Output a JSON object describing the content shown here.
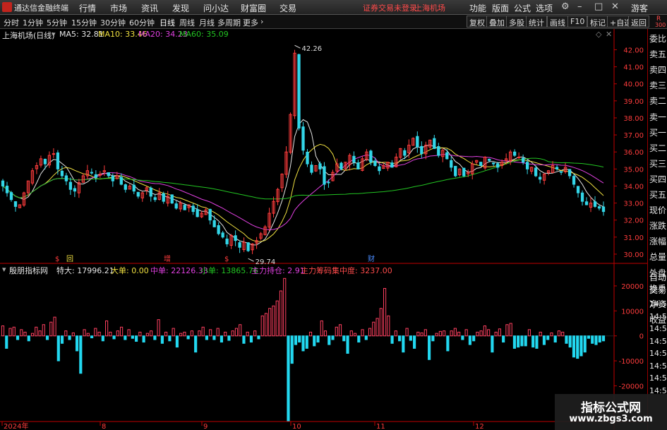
{
  "app": {
    "title": "通达信金融终端"
  },
  "menu": [
    "行情",
    "市场",
    "资讯",
    "发现",
    "问小达",
    "财富圈",
    "交易"
  ],
  "login": {
    "status": "证券交易未登录",
    "market": "上海机场"
  },
  "right_menu": [
    "功能",
    "版面",
    "公式",
    "选项"
  ],
  "window_controls": {
    "settings": "⚙",
    "minimize": "–",
    "maximize": "□",
    "close": "✕"
  },
  "guest": "游客",
  "periods": [
    "分时",
    "1分钟",
    "5分钟",
    "15分钟",
    "30分钟",
    "60分钟",
    "日线",
    "周线",
    "月线",
    "多周期",
    "更多"
  ],
  "active_period": "日线",
  "more_arrow": "›",
  "tool_buttons": [
    "复权",
    "叠加",
    "多股",
    "统计",
    "画线",
    "F10",
    "标记",
    "+自选",
    "返回"
  ],
  "corner": {
    "r": "R",
    "num": "300"
  },
  "main_info": {
    "stock": "上海机场(日线)",
    "ma5": "MA5: 32.81",
    "ma10": "MA10: 33.46",
    "ma20": "MA20: 34.23",
    "ma60": "MA60: 35.09"
  },
  "indicator_info": {
    "name": "殷朋指标网",
    "td_label": "特大: 17996.21",
    "dd_label": "大单: 0.00",
    "zd_label": "中单: 22126.33",
    "xd_label": "小单: 13865.76",
    "zl_label": "主力持仓: 2.91",
    "jzd_label": "主力筹码集中度: 3237.00"
  },
  "side_panel": {
    "items": [
      "委比",
      "卖五",
      "卖四",
      "卖三",
      "卖二",
      "卖一",
      "买一",
      "买二",
      "买三",
      "买四",
      "买五",
      "现价",
      "涨跌",
      "涨幅",
      "总量",
      "外盘",
      "换手",
      "净资",
      "收益"
    ],
    "lower": [
      "自动",
      "交易"
    ],
    "times": [
      "14:56",
      "14:56",
      "14:56",
      "14:56",
      "14:56",
      "14:56",
      "14:56",
      "14:56"
    ]
  },
  "colors": {
    "up": "#ff3c3c",
    "down": "#33d6e8",
    "ma5": "#e6e6e6",
    "ma10": "#f0e040",
    "ma20": "#e040e0",
    "ma60": "#22c422",
    "indicator_up": "#ff4060",
    "indicator_down": "#22d8f0",
    "axis_red": "#c00000"
  },
  "chart_data": [
    {
      "type": "candlestick",
      "y_ticks": [
        "42.00",
        "41.00",
        "40.00",
        "39.00",
        "38.00",
        "37.00",
        "36.00",
        "35.00",
        "34.00",
        "33.00",
        "32.00",
        "31.00",
        "30.00"
      ],
      "ylim": [
        29.5,
        42.6
      ],
      "high_label": "42.26",
      "low_label": "29.74",
      "x_labels": [
        "2024年",
        "8",
        "9",
        "10",
        "11",
        "12"
      ],
      "events": [
        "$",
        "回",
        "增",
        "$",
        "财"
      ],
      "closes": [
        34.0,
        33.6,
        33.2,
        32.8,
        32.9,
        33.6,
        34.3,
        34.9,
        35.2,
        35.6,
        35.3,
        35.8,
        35.9,
        35.0,
        34.6,
        34.3,
        33.8,
        33.7,
        34.2,
        34.6,
        34.9,
        34.8,
        34.5,
        34.7,
        34.9,
        34.6,
        34.3,
        34.6,
        34.1,
        33.8,
        34.0,
        33.7,
        33.4,
        33.6,
        33.9,
        33.4,
        33.2,
        33.6,
        33.1,
        33.4,
        33.0,
        32.7,
        33.0,
        32.6,
        32.9,
        32.5,
        32.2,
        32.4,
        32.6,
        32.0,
        31.6,
        31.2,
        31.0,
        30.6,
        31.1,
        30.8,
        30.4,
        30.7,
        30.2,
        30.6,
        30.8,
        31.2,
        31.6,
        32.4,
        33.1,
        33.8,
        34.7,
        36.0,
        38.2,
        41.8,
        37.4,
        36.1,
        35.3,
        34.8,
        35.2,
        35.0,
        34.1,
        34.2,
        34.8,
        35.3,
        35.0,
        35.4,
        35.8,
        35.4,
        35.0,
        35.6,
        36.0,
        35.4,
        35.2,
        34.9,
        35.2,
        35.4,
        35.1,
        35.7,
        36.2,
        35.8,
        36.4,
        36.8,
        36.3,
        35.9,
        36.4,
        36.7,
        36.2,
        35.8,
        36.1,
        35.6,
        35.1,
        34.6,
        35.0,
        34.6,
        34.8,
        35.3,
        35.5,
        35.2,
        35.7,
        35.5,
        35.3,
        35.1,
        35.4,
        35.6,
        36.0,
        35.8,
        35.7,
        35.4,
        35.0,
        35.1,
        34.6,
        34.4,
        34.7,
        34.9,
        35.2,
        35.0,
        34.8,
        35.1,
        34.6,
        34.1,
        33.6,
        33.1,
        32.9,
        33.0,
        32.8,
        32.7,
        32.5
      ],
      "ma5_last": 32.81,
      "ma10_last": 33.46,
      "ma20_last": 34.23,
      "ma60_last": 35.09
    },
    {
      "type": "bar",
      "y_ticks": [
        "20000",
        "10000",
        "0",
        "-10000",
        "-20000"
      ],
      "ylim": [
        -34000,
        24500
      ],
      "values": [
        4000,
        -5000,
        3000,
        3500,
        -1500,
        2500,
        1500,
        -2000,
        1000,
        3500,
        2000,
        4500,
        -1500,
        5500,
        7500,
        -10000,
        -3000,
        2000,
        -1500,
        1200,
        -6000,
        -15000,
        2500,
        1000,
        -800,
        3000,
        1500,
        -2000,
        6000,
        1500,
        -1200,
        2000,
        3500,
        -1500,
        2500,
        -1000,
        -2200,
        1500,
        -2500,
        1000,
        2000,
        -1500,
        6500,
        -3000,
        1500,
        -2000,
        3000,
        -4500,
        1000,
        1500,
        -1200,
        2000,
        -6500,
        2000,
        3500,
        -1500,
        2500,
        -1500,
        3000,
        -2500,
        1500,
        -1800,
        2000,
        3000,
        4500,
        -3000,
        1500,
        -2500,
        2000,
        -1200,
        8000,
        9000,
        11000,
        12000,
        14000,
        18000,
        23000,
        -34000,
        -11000,
        -3500,
        -2500,
        -6000,
        -5000,
        1500,
        -4000,
        -2500,
        6000,
        2000,
        -3500,
        -1500,
        3500,
        4500,
        -2000,
        -7000,
        2000,
        1000,
        -2500,
        2500,
        -1500,
        3000,
        5500,
        7000,
        11000,
        19000,
        8000,
        -3000,
        2000,
        -2000,
        -6500,
        3000,
        -1800,
        -5000,
        1500,
        1200,
        2500,
        -9500,
        -2000,
        1000,
        1800,
        2000,
        -6000,
        2000,
        3000,
        1500,
        -1500,
        2500,
        -3500,
        -2000,
        1500,
        2000,
        4000,
        2500,
        -6500,
        1500,
        2800,
        -2500,
        4500,
        5000,
        -5000,
        -4500,
        -4000,
        -4000,
        2500,
        -4500,
        -5000,
        1500,
        -3500,
        -1500,
        1200,
        -2500,
        2000,
        1500,
        -3000,
        -4500,
        -8500,
        -9000,
        -8000,
        -6500,
        -1000,
        -3000,
        -3500,
        -2500,
        -2000
      ]
    }
  ]
}
